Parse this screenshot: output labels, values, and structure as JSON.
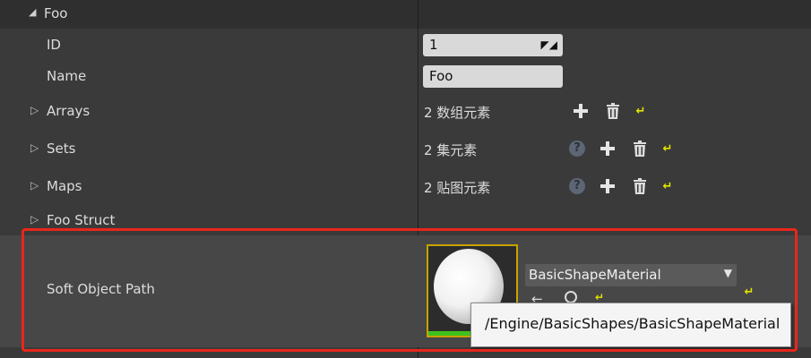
{
  "category": {
    "title": "Foo"
  },
  "rows": {
    "id": {
      "label": "ID",
      "value": "1"
    },
    "name": {
      "label": "Name",
      "value": "Foo"
    },
    "arrays": {
      "label": "Arrays",
      "value": "2 数组元素"
    },
    "sets": {
      "label": "Sets",
      "value": "2 集元素"
    },
    "maps": {
      "label": "Maps",
      "value": "2 贴图元素"
    },
    "foo_struct": {
      "label": "Foo Struct"
    },
    "soft_object_path": {
      "label": "Soft Object Path",
      "asset_name": "BasicShapeMaterial",
      "tooltip": "/Engine/BasicShapes/BasicShapeMaterial"
    }
  },
  "icons": {
    "add": "plus-icon",
    "delete": "trash-icon",
    "reset": "reset-arrow-icon",
    "help": "help-icon",
    "collapse": "triangle-down-icon",
    "expand": "triangle-right-icon"
  },
  "colors": {
    "panel_bg": "#3a3a3a",
    "highlight_row_bg": "#474747",
    "highlight_border": "#e8261b",
    "reset_yellow": "#e3e300",
    "thumbnail_border": "#c8a300",
    "thumbnail_bar": "#3ec11d"
  }
}
